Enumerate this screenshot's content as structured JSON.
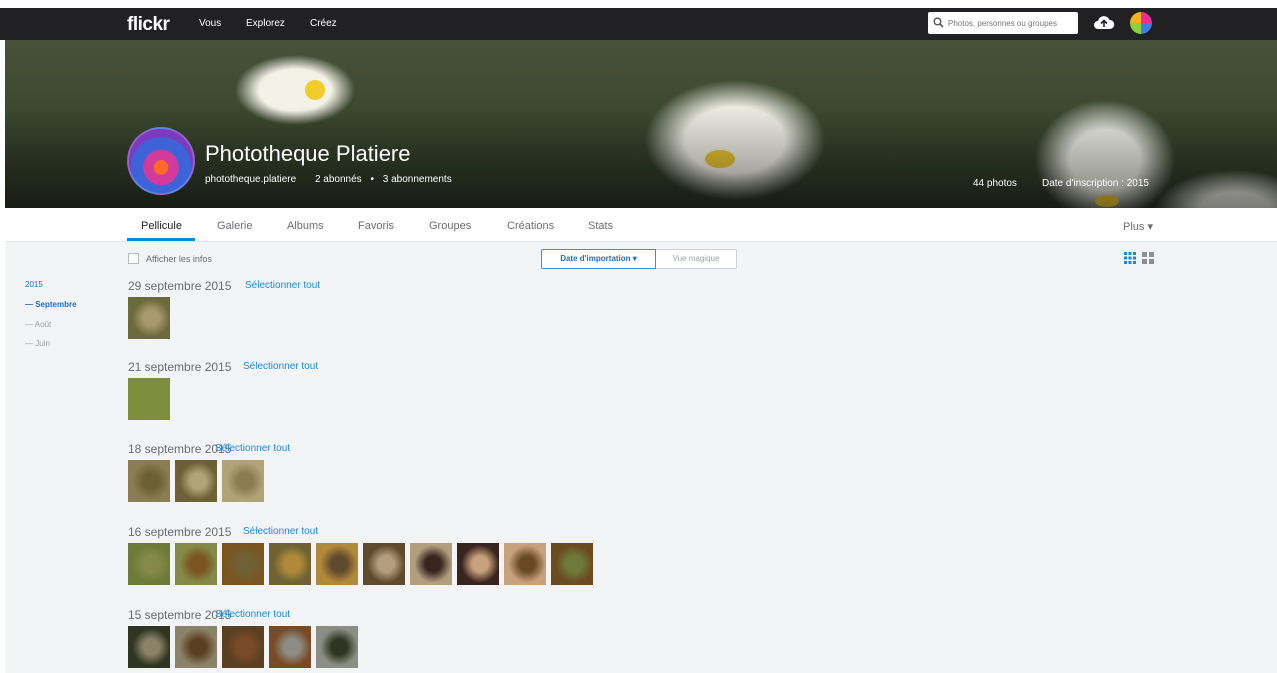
{
  "topnav": {
    "logo": "flickr",
    "links": [
      "Vous",
      "Explorez",
      "Créez"
    ],
    "search_placeholder": "Photos, personnes ou groupes"
  },
  "profile": {
    "name": "Phototheque Platiere",
    "username": "phototheque.platiere",
    "followers": "2 abonnés",
    "following": "3 abonnements",
    "separator": "•",
    "photos_count": "44 photos",
    "joined": "Date d'inscription : 2015"
  },
  "tabs": [
    "Pellicule",
    "Galerie",
    "Albums",
    "Favoris",
    "Groupes",
    "Créations",
    "Stats"
  ],
  "tabs_more": "Plus ▾",
  "toolbar": {
    "show_info": "Afficher les infos",
    "sort_active": "Date d'importation ▾",
    "sort_other": "Vue magique"
  },
  "timeline": {
    "year": "2015",
    "months": [
      "— Septembre",
      "— Août",
      "— Juin"
    ]
  },
  "groups": [
    {
      "date": "29 septembre 2015",
      "select": "Sélectionner tout",
      "thumbs": [
        "#6b6a3c",
        "#a89a6c"
      ]
    },
    {
      "date": "21 septembre 2015",
      "select": "Sélectionner tout",
      "thumbs": [
        "#7d8f3d"
      ]
    },
    {
      "date": "18 septembre 2015",
      "select": "Sélectionner tout",
      "thumbs": [
        "#8a7d52",
        "#6d6034",
        "#b0a476"
      ]
    },
    {
      "date": "16 septembre 2015",
      "select": "Sélectionner tout",
      "thumbs": [
        "#6e7a3a",
        "#858a48",
        "#7a5520",
        "#6e6234",
        "#b08a3a",
        "#5f4a2e",
        "#b39e7e",
        "#3b2420",
        "#c7a27c",
        "#6b4a22"
      ]
    },
    {
      "date": "15 septembre 2015",
      "select": "Sélectionner tout",
      "thumbs": [
        "#2f3520",
        "#8b826a",
        "#5a4020",
        "#7a4a26",
        "#8c8e86"
      ]
    }
  ],
  "colors": {
    "nav_bg": "#212124",
    "accent_blue": "#1c6fc4",
    "tab_underline": "#008ecf",
    "page_bg": "#f2f4f5"
  },
  "icons": [
    "search-icon",
    "upload-cloud-icon",
    "grid-view-icon",
    "mosaic-view-icon",
    "checkbox"
  ]
}
